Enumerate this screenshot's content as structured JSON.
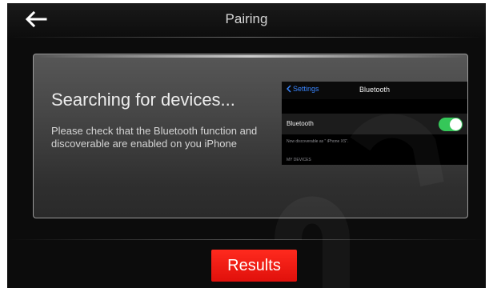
{
  "header": {
    "title": "Pairing",
    "back_icon": "arrow-left-icon"
  },
  "card": {
    "heading": "Searching for devices...",
    "instructions": "Please check that the Bluetooth function and discoverable are enabled on you iPhone"
  },
  "phone": {
    "back_label": "Settings",
    "title": "Bluetooth",
    "row_label": "Bluetooth",
    "toggle_on": true,
    "discoverable_note": "Now discoverable as \" iPhone XS\".",
    "section_label": "MY DEVICES"
  },
  "footer": {
    "results_label": "Results"
  },
  "colors": {
    "accent": "#e0100b",
    "toggle": "#35c759",
    "ios_link": "#3a86ff"
  }
}
